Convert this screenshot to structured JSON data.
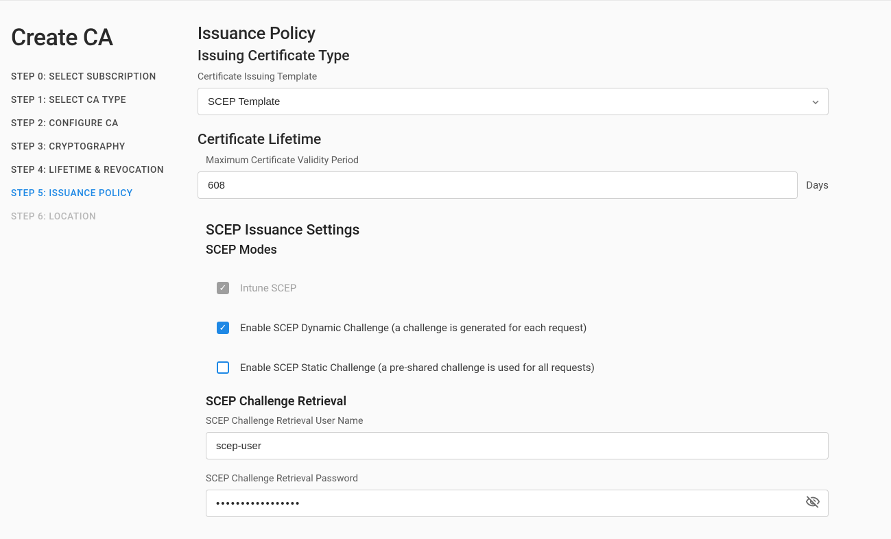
{
  "pageTitle": "Create CA",
  "steps": [
    {
      "label": "STEP 0: SELECT SUBSCRIPTION",
      "state": "normal"
    },
    {
      "label": "STEP 1: SELECT CA TYPE",
      "state": "normal"
    },
    {
      "label": "STEP 2: CONFIGURE CA",
      "state": "normal"
    },
    {
      "label": "STEP 3: CRYPTOGRAPHY",
      "state": "normal"
    },
    {
      "label": "STEP 4: LIFETIME & REVOCATION",
      "state": "normal"
    },
    {
      "label": "STEP 5: ISSUANCE POLICY",
      "state": "active"
    },
    {
      "label": "STEP 6: LOCATION",
      "state": "disabled"
    }
  ],
  "main": {
    "sectionTitle": "Issuance Policy",
    "issuingType": {
      "title": "Issuing Certificate Type",
      "fieldLabel": "Certificate Issuing Template",
      "selectedValue": "SCEP Template"
    },
    "certLifetime": {
      "title": "Certificate Lifetime",
      "fieldLabel": "Maximum Certificate Validity Period",
      "value": "608",
      "unit": "Days"
    },
    "scep": {
      "settingsTitle": "SCEP Issuance Settings",
      "modesTitle": "SCEP Modes",
      "modes": [
        {
          "label": "Intune SCEP",
          "checked": true,
          "disabled": true
        },
        {
          "label": "Enable SCEP Dynamic Challenge (a challenge is generated for each request)",
          "checked": true,
          "disabled": false
        },
        {
          "label": "Enable SCEP Static Challenge (a pre-shared challenge is used for all requests)",
          "checked": false,
          "disabled": false
        }
      ],
      "retrieval": {
        "title": "SCEP Challenge Retrieval",
        "userLabel": "SCEP Challenge Retrieval User Name",
        "userValue": "scep-user",
        "passwordLabel": "SCEP Challenge Retrieval Password",
        "passwordValue": "•••••••••••••••••"
      }
    }
  }
}
